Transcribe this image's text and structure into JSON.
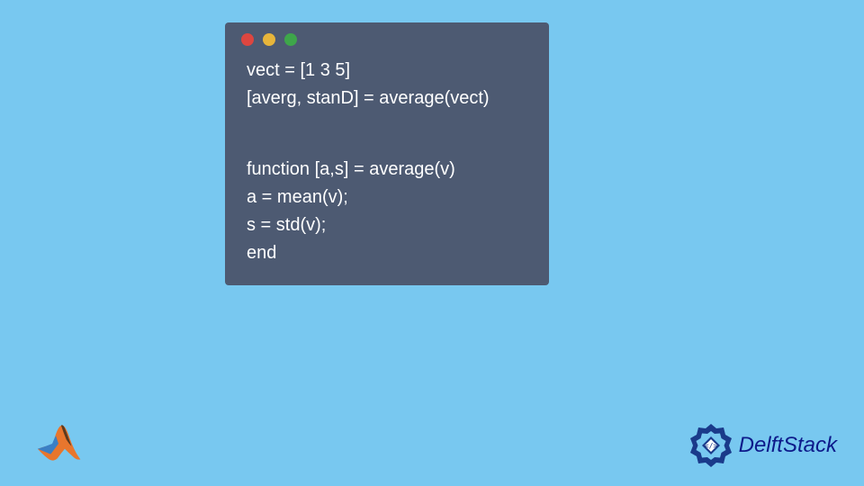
{
  "code": {
    "lines": [
      "vect = [1 3 5]",
      "[averg, stanD] = average(vect)",
      "",
      "",
      "function [a,s] = average(v)",
      "a = mean(v);",
      "s = std(v);",
      "end"
    ]
  },
  "branding": {
    "site_name": "DelftStack"
  },
  "colors": {
    "window_bg": "#4d5a72",
    "page_bg": "#78c8f0",
    "code_text": "#ffffff",
    "brand_text": "#0d1a8a"
  }
}
